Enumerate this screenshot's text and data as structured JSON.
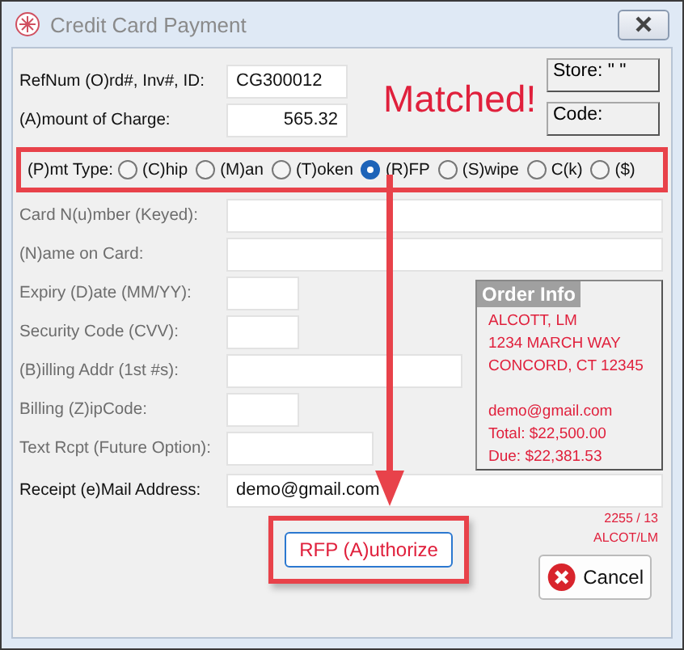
{
  "window": {
    "title": "Credit Card Payment"
  },
  "header_fields": [
    {
      "label": "RefNum (O)rd#, Inv#, ID:",
      "value": "CG300012"
    },
    {
      "label": "(A)mount of Charge:",
      "value": "565.32"
    }
  ],
  "match_status": "Matched!",
  "side_buttons": [
    "Store: \" \"",
    "Code:"
  ],
  "payment_type": {
    "label": "(P)mt Type:",
    "options": [
      {
        "label": "(C)hip",
        "selected": false
      },
      {
        "label": "(M)an",
        "selected": false
      },
      {
        "label": "(T)oken",
        "selected": false
      },
      {
        "label": "(R)FP",
        "selected": true
      },
      {
        "label": "(S)wipe",
        "selected": false
      },
      {
        "label": "C(k)",
        "selected": false
      },
      {
        "label": "($)",
        "selected": false
      }
    ]
  },
  "card_fields": [
    {
      "label": "Card N(u)mber (Keyed):",
      "disabled": true
    },
    {
      "label": "(N)ame on Card:",
      "disabled": true
    }
  ],
  "detail_fields": [
    {
      "label": "Expiry (D)ate (MM/YY):",
      "disabled": true
    },
    {
      "label": "Security Code (CVV):",
      "disabled": true
    },
    {
      "label": "(B)illing Addr (1st #s):",
      "disabled": true
    },
    {
      "label": "Billing (Z)ipCode:",
      "disabled": true
    },
    {
      "label": "Text Rcpt (Future Option):",
      "disabled": true
    }
  ],
  "order_info": {
    "title": "Order Info",
    "lines": [
      "ALCOTT, LM",
      "1234 MARCH WAY",
      "CONCORD, CT  12345",
      "demo@gmail.com",
      "Total: $22,500.00",
      "Due: $22,381.53"
    ]
  },
  "email_field": {
    "label": "Receipt (e)Mail Address:",
    "value": "demo@gmail.com",
    "disabled": false
  },
  "footer_info": [
    "2255 / 13",
    "ALCOT/LM"
  ],
  "authorize_button": "RFP (A)uthorize",
  "cancel_button": "Cancel"
}
